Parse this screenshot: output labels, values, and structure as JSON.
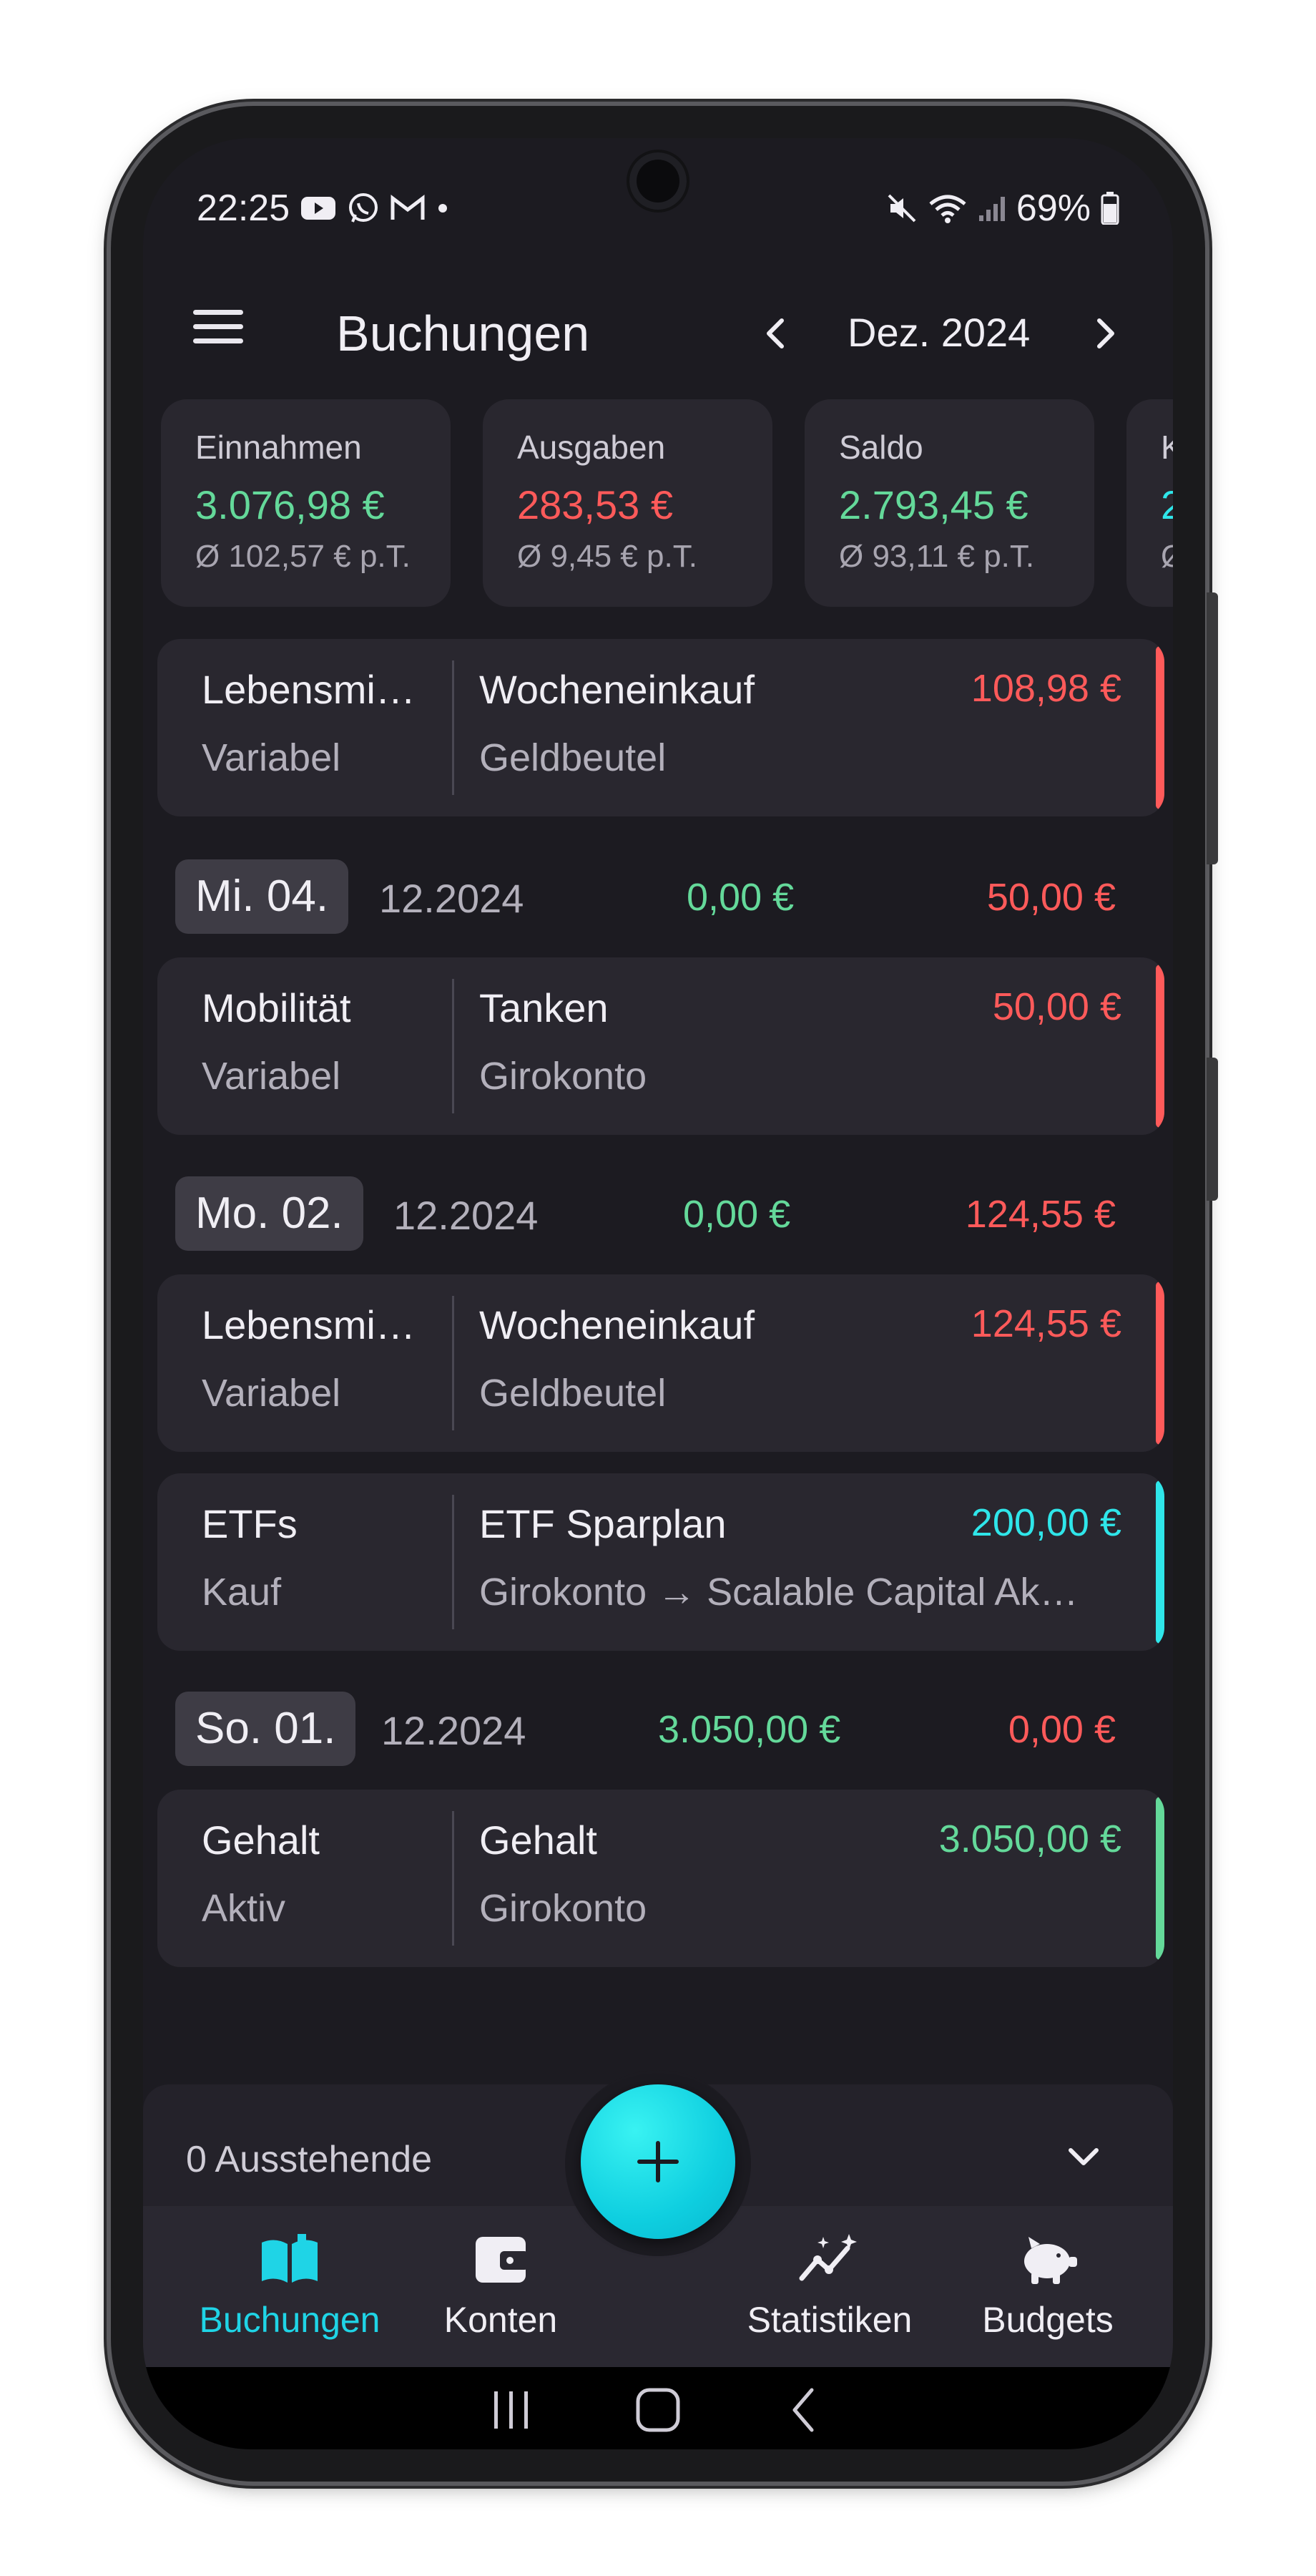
{
  "colors": {
    "income": "#64d99a",
    "expense": "#ff5a5a",
    "transfer": "#2fe6ea",
    "accent": "#1fd4e6",
    "surface": "#29272f",
    "background": "#1c1b21"
  },
  "status_bar": {
    "time": "22:25",
    "battery": "69%",
    "notification_icons": [
      "youtube-icon",
      "whatsapp-icon",
      "gmail-icon",
      "dot-icon"
    ],
    "system_icons": [
      "mute-icon",
      "wifi-icon",
      "signal-icon",
      "battery-icon"
    ]
  },
  "header": {
    "title": "Buchungen",
    "month": "Dez. 2024"
  },
  "summary": [
    {
      "label": "Einnahmen",
      "value": "3.076,98 €",
      "avg": "Ø 102,57 € p.T.",
      "color": "#64d99a"
    },
    {
      "label": "Ausgaben",
      "value": "283,53 €",
      "avg": "Ø 9,45 € p.T.",
      "color": "#ff5a5a"
    },
    {
      "label": "Saldo",
      "value": "2.793,45 €",
      "avg": "Ø 93,11 € p.T.",
      "color": "#64d99a"
    },
    {
      "label": "K",
      "value": "2",
      "avg": "Ø",
      "color": "#2fe6ea"
    }
  ],
  "transactions": [
    {
      "category": "Lebensmi…",
      "subcategory": "Variabel",
      "description": "Wocheneinkauf",
      "account": "Geldbeutel",
      "amount": "108,98 €",
      "kind": "expense"
    },
    {
      "category": "Mobilität",
      "subcategory": "Variabel",
      "description": "Tanken",
      "account": "Girokonto",
      "amount": "50,00 €",
      "kind": "expense"
    },
    {
      "category": "Lebensmi…",
      "subcategory": "Variabel",
      "description": "Wocheneinkauf",
      "account": "Geldbeutel",
      "amount": "124,55 €",
      "kind": "expense"
    },
    {
      "category": "ETFs",
      "subcategory": "Kauf",
      "description": "ETF Sparplan",
      "account": "Girokonto → Scalable Capital Ak…",
      "amount": "200,00 €",
      "kind": "transfer"
    },
    {
      "category": "Gehalt",
      "subcategory": "Aktiv",
      "description": "Gehalt",
      "account": "Girokonto",
      "amount": "3.050,00 €",
      "kind": "income"
    }
  ],
  "days": [
    {
      "day": "Mi. 04.",
      "date": "12.2024",
      "income": "0,00 €",
      "expense": "50,00 €"
    },
    {
      "day": "Mo. 02.",
      "date": "12.2024",
      "income": "0,00 €",
      "expense": "124,55 €"
    },
    {
      "day": "So. 01.",
      "date": "12.2024",
      "income": "3.050,00 €",
      "expense": "0,00 €"
    }
  ],
  "pending": {
    "label": "0 Ausstehende"
  },
  "bottom_nav": [
    {
      "label": "Buchungen",
      "icon": "book-icon",
      "active": true
    },
    {
      "label": "Konten",
      "icon": "wallet-icon",
      "active": false
    },
    {
      "label": "Statistiken",
      "icon": "chart-sparkle-icon",
      "active": false
    },
    {
      "label": "Budgets",
      "icon": "piggy-bank-icon",
      "active": false
    }
  ]
}
